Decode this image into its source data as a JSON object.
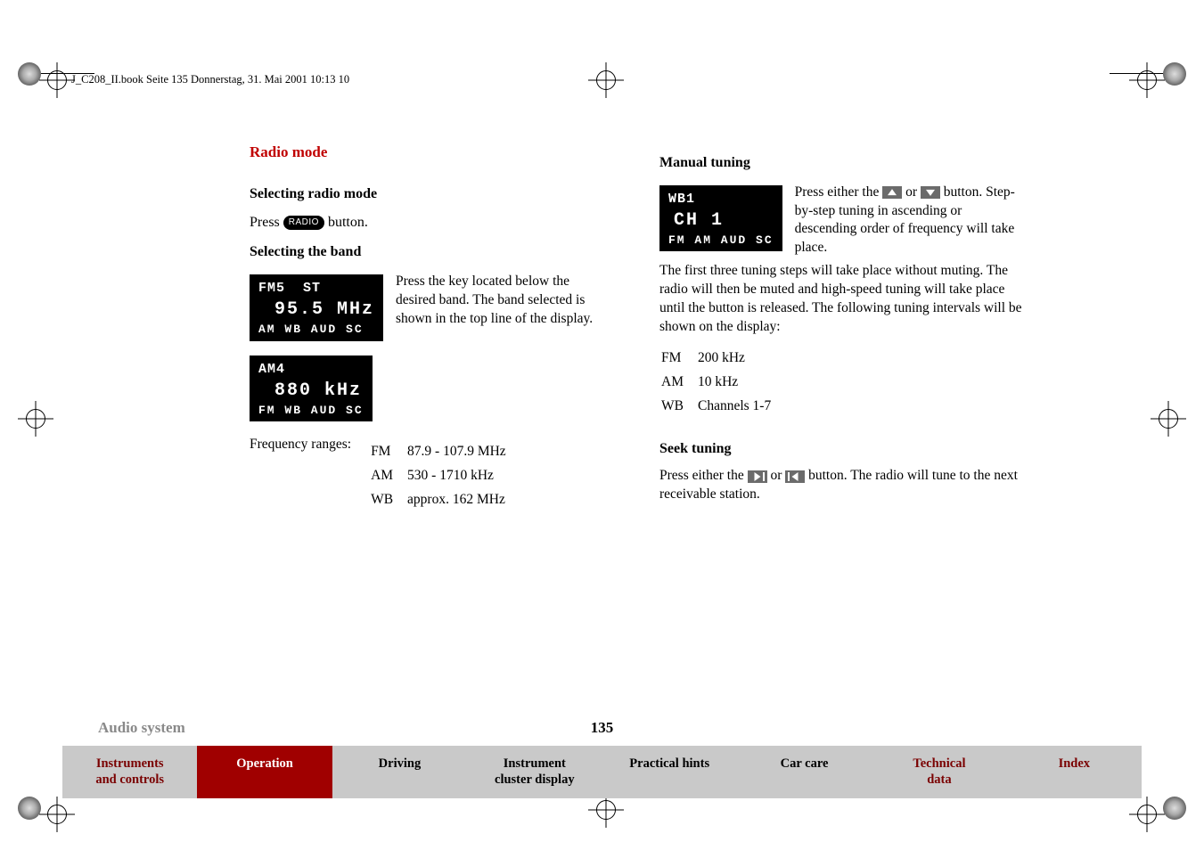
{
  "header": {
    "filepath_line": "J_C208_II.book  Seite 135  Donnerstag, 31. Mai 2001  10:13 10"
  },
  "left": {
    "heading": "Radio mode",
    "sec1_title": "Selecting radio mode",
    "sec1_text_a": "Press ",
    "sec1_btn": "RADIO",
    "sec1_text_b": " button.",
    "sec2_title": "Selecting the band",
    "lcd1": {
      "row1": "FM5  ST",
      "big": "95.5 MHz",
      "row3": "AM WB AUD SC"
    },
    "sec2_para": "Press the key located below the desired band. The band selected is shown in the top line of the display.",
    "lcd2": {
      "row1": "AM4",
      "big": "880 kHz",
      "row3": "FM WB AUD SC"
    },
    "freq_label": "Frequency ranges:",
    "freq_rows": [
      {
        "band": "FM",
        "range": "87.9 - 107.9 MHz"
      },
      {
        "band": "AM",
        "range": "530 - 1710 kHz"
      },
      {
        "band": "WB",
        "range": "approx. 162 MHz"
      }
    ]
  },
  "right": {
    "sec3_title": "Manual tuning",
    "lcd3": {
      "row1": "WB1",
      "big": "CH 1",
      "row3": "FM AM AUD SC"
    },
    "sec3_beside_a": "Press either the ",
    "sec3_beside_b": " or ",
    "sec3_beside_c": " button. Step-by-step tuning in ascending or descending order of frequency will take place.",
    "sec3_para": "The first three tuning steps will take place without muting. The radio will then be muted and high-speed tuning will take place until the button is released. The following tuning intervals will be shown on the display:",
    "interval_rows": [
      {
        "band": "FM",
        "val": "200 kHz"
      },
      {
        "band": "AM",
        "val": "10 kHz"
      },
      {
        "band": "WB",
        "val": "Channels 1-7"
      }
    ],
    "sec4_title": "Seek tuning",
    "sec4_a": "Press either the ",
    "sec4_b": " or ",
    "sec4_c": " button. The radio will tune to the next receivable station."
  },
  "footer": {
    "section": "Audio system",
    "page": "135",
    "nav": [
      {
        "label": "Instruments\nand controls",
        "active": false
      },
      {
        "label": "Operation",
        "active": true
      },
      {
        "label": "Driving",
        "active": false
      },
      {
        "label": "Instrument\ncluster display",
        "active": false
      },
      {
        "label": "Practical hints",
        "active": false
      },
      {
        "label": "Car care",
        "active": false
      },
      {
        "label": "Technical\ndata",
        "active": false
      },
      {
        "label": "Index",
        "active": false
      }
    ]
  }
}
